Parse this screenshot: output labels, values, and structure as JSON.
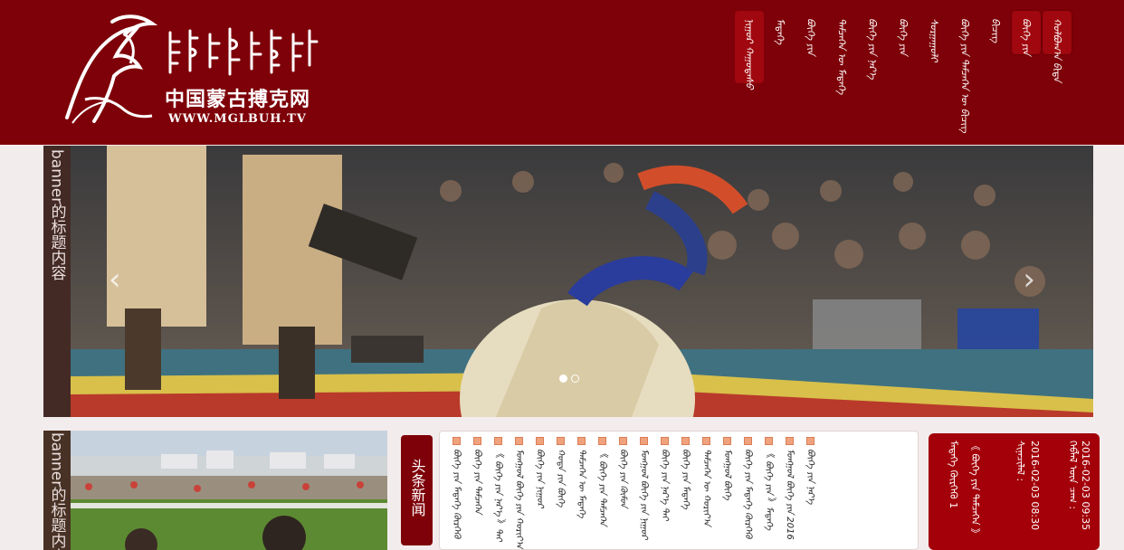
{
  "brand": {
    "mongolian_title": "ᠮᠣᠩᠭᠣᠯ ᠪᠦᠬᠡ",
    "chinese_name": "中国蒙古搏克网",
    "url": "WWW.MGLBUH.TV"
  },
  "nav": {
    "items": [
      {
        "label": "ᠨᠢᠭᠤᠷ ᠬᠠᠭᠤᠳᠠᠰᠤ"
      },
      {
        "label": "ᠮᠡᠳᠡᠭᠡ"
      },
      {
        "label": "ᠪᠦᠬᠡ ᠶᠢᠨ"
      },
      {
        "label": "ᠲᠡᠮᠴᠡᠭᠡᠨ ᠦ ᠮᠡᠳᠡᠭᠡ"
      },
      {
        "label": "ᠪᠦᠬᠡ ᠶᠢᠨ ᠨᠡᠷ᠎ᠡ"
      },
      {
        "label": "ᠪᠦᠬᠡ ᠶᠢᠨ"
      },
      {
        "label": "ᠰᠤᠷᠭᠠᠭᠤᠯᠢ"
      },
      {
        "label": "ᠪᠦᠬᠡ ᠶᠢᠨ ᠲᠡᠮᠴᠡᠭᠡᠨ ᠦ ᠪᠢᠴᠢᠭ"
      },
      {
        "label": "ᠪᠢᠴᠢᠭ"
      },
      {
        "label": "ᠪᠦᠬᠡ ᠶᠢᠨ"
      },
      {
        "label": "ᠬᠣᠯᠪᠣᠭ᠎ᠠ ᠪᠢᠳᠡ"
      }
    ]
  },
  "banner": {
    "caption": "banner的标题内容",
    "prev_arrow": "‹",
    "next_arrow": "›"
  },
  "small_banner": {
    "caption": "banner的标题内容"
  },
  "headline": {
    "label": "头条新闻"
  },
  "news": {
    "items": [
      "ᠪᠦᠬᠡ ᠶᠢᠨ ᠮᠡᠳᠡᠭᠡ ᠬᠦᠷᠭᠡᠬᠦ",
      "ᠪᠦᠬᠡ ᠶᠢᠨ ᠲᠡᠮᠴᠡᠭᠡᠨ",
      "《 ᠪᠦᠬᠡ ᠶᠢᠨ ᠨᠡᠷ᠎ᠡ 》ᠲᠠᠢ",
      "ᠮᠣᠩᠭᠣᠯ ᠪᠦᠬᠡ ᠶᠢᠨ ᠬᠣᠷᠢᠶ᠎ᠠ",
      "ᠪᠦᠬᠡ ᠶᠢᠨ ᠨᠢᠭᠤᠷ",
      "ᠬᠣᠲᠠ ᠶᠢᠨ ᠪᠦᠬᠡ",
      "ᠲᠡᠮᠴᠡᠭᠡᠨ ᠦ ᠮᠡᠳᠡᠭᠡ",
      "《 ᠪᠦᠬᠡ ᠶᠢᠨ ᠲᠡᠮᠴᠡᠭᠡᠨ",
      "ᠪᠦᠬᠡ ᠶᠢᠨ ᠬᠦᠮᠦᠨ",
      "ᠮᠣᠩᠭᠣᠯ ᠪᠦᠬᠡ ᠶᠢᠨ ᠨᠢᠭᠤᠷ",
      "ᠪᠦᠬᠡ ᠶᠢᠨ ᠨᠡᠷ᠎ᠡ ᠲᠠᠢ",
      "ᠪᠦᠬᠡ ᠶᠢᠨ ᠮᠡᠳᠡᠭᠡ",
      "ᠲᠡᠮᠴᠡᠭᠡᠨ ᠦ ᠬᠣᠷᠢᠶ᠎ᠠ",
      "ᠮᠣᠩᠭᠣᠯ ᠪᠦᠬᠡ",
      "ᠪᠦᠬᠡ ᠶᠢᠨ ᠮᠡᠳᠡᠭᠡ ᠬᠦᠷᠭᠡᠬᠦ",
      "《 ᠪᠦᠬᠡ ᠶᠢᠨ 》ᠮᠡᠳᠡᠭᠡ",
      "ᠮᠣᠩᠭᠣᠯ ᠪᠦᠬᠡ ᠶᠢᠨ 2016",
      "ᠪᠦᠬᠡ ᠶᠢᠨ ᠨᠡᠷ᠎ᠡ"
    ]
  },
  "info": {
    "col1": "ᠬᠡᠪᠯᠡᠯ ᠦᠨ ᠴᠠᠭ :",
    "col1_value": "2016-02-03 09:35",
    "col2": "ᠰᠢᠨᠡᠴᠢᠯᠡᠯ :",
    "col2_value": "2016-02-03 08:30",
    "col3": "《 ᠪᠦᠬᠡ ᠶᠢᠨ ᠲᠡᠮᠴᠡᠭᠡᠨ 》",
    "col4": "ᠮᠡᠳᠡᠭᠡ ᠬᠦᠷᠭᠡᠬᠦ 1"
  },
  "colors": {
    "header_bg": "#7e0008",
    "accent": "#a3000a",
    "bullet": "#f0a27d"
  }
}
